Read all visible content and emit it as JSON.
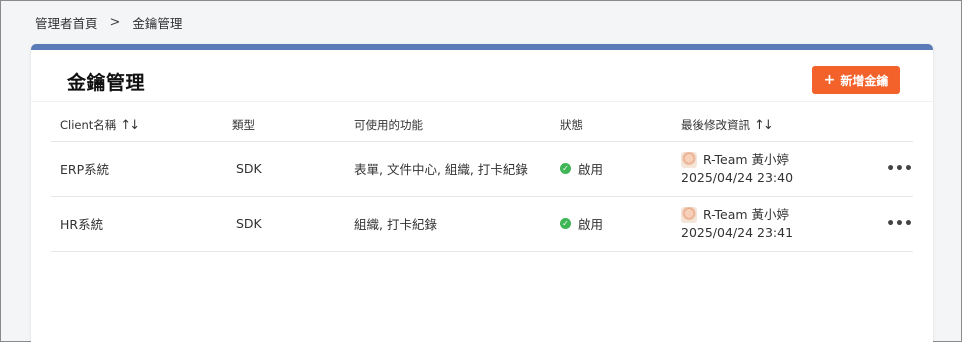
{
  "breadcrumb": {
    "home": "管理者首頁",
    "separator": ">",
    "current": "金鑰管理"
  },
  "card": {
    "title": "金鑰管理",
    "add_button": "新增金鑰",
    "add_icon": "+"
  },
  "table": {
    "headers": {
      "client": "Client名稱",
      "type": "類型",
      "functions": "可使用的功能",
      "status": "狀態",
      "modified": "最後修改資訊",
      "sort_icon": "↑↓"
    },
    "rows": [
      {
        "client": "ERP系統",
        "type": "SDK",
        "functions": "表單, 文件中心, 組織, 打卡紀錄",
        "status": "啟用",
        "modified_by": "R-Team 黃小婷",
        "modified_at": "2025/04/24 23:40",
        "more": "•••"
      },
      {
        "client": "HR系統",
        "type": "SDK",
        "functions": "組織, 打卡紀錄",
        "status": "啟用",
        "modified_by": "R-Team 黃小婷",
        "modified_at": "2025/04/24 23:41",
        "more": "•••"
      }
    ]
  },
  "colors": {
    "accent": "#f4622c",
    "topbar": "#5b7ab8",
    "status_ok": "#3fb655"
  }
}
